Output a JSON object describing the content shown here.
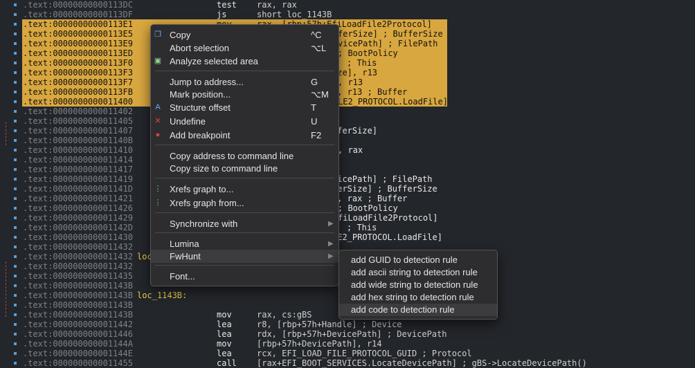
{
  "listing": [
    {
      "addr": ".text:00000000000113DC",
      "mn": "test",
      "op": "rax, rax",
      "comment": "",
      "label": "",
      "hl": false
    },
    {
      "addr": ".text:00000000000113DF",
      "mn": "js",
      "op": "short loc_1143B",
      "comment": "",
      "label": "",
      "hl": false
    },
    {
      "addr": ".text:00000000000113E1",
      "mn": "mov",
      "op": "rax, [rbp+57h+EfiLoadFile2Protocol]",
      "comment": "",
      "label": "",
      "hl": true
    },
    {
      "addr": ".text:00000000000113E5",
      "mn": "",
      "op": "",
      "comment": "ferSize] ; BufferSize",
      "label": "",
      "hl": true
    },
    {
      "addr": ".text:00000000000113E9",
      "mn": "",
      "op": "",
      "comment": "vicePath] ; FilePath",
      "label": "",
      "hl": true
    },
    {
      "addr": ".text:00000000000113ED",
      "mn": "",
      "op": "",
      "comment": "; BootPolicy",
      "label": "",
      "hl": true
    },
    {
      "addr": ".text:00000000000113F0",
      "mn": "",
      "op": "",
      "comment": "; This",
      "label": "",
      "hl": true
    },
    {
      "addr": ".text:00000000000113F3",
      "mn": "",
      "op": "",
      "comment": "ize], r13",
      "label": "",
      "hl": true
    },
    {
      "addr": ".text:00000000000113F7",
      "mn": "",
      "op": "",
      "comment": ", r13",
      "label": "",
      "hl": true
    },
    {
      "addr": ".text:00000000000113FB",
      "mn": "",
      "op": "",
      "comment": "], r13 ; Buffer",
      "label": "",
      "hl": true
    },
    {
      "addr": ".text:0000000000011400",
      "mn": "",
      "op": "",
      "comment": "LE2_PROTOCOL.LoadFile]",
      "label": "",
      "hl": true
    },
    {
      "addr": ".text:0000000000011402",
      "mn": "",
      "op": "",
      "comment": "",
      "label": "",
      "hl": false
    },
    {
      "addr": ".text:0000000000011405",
      "mn": "",
      "op": "",
      "comment": "",
      "label": "",
      "hl": false
    },
    {
      "addr": ".text:0000000000011407",
      "mn": "",
      "op": "",
      "comment": "fferSize]",
      "label": "",
      "hl": false
    },
    {
      "addr": ".text:000000000001140B",
      "mn": "",
      "op": "",
      "comment": "",
      "label": "",
      "hl": false
    },
    {
      "addr": ".text:0000000000011410",
      "mn": "",
      "op": "",
      "comment": ", rax",
      "label": "",
      "hl": false
    },
    {
      "addr": ".text:0000000000011414",
      "mn": "",
      "op": "",
      "comment": "",
      "label": "",
      "hl": false
    },
    {
      "addr": ".text:0000000000011417",
      "mn": "",
      "op": "",
      "comment": "",
      "label": "",
      "hl": false
    },
    {
      "addr": ".text:0000000000011419",
      "mn": "",
      "op": "",
      "comment": "vicePath] ; FilePath",
      "label": "",
      "hl": false
    },
    {
      "addr": ".text:000000000001141D",
      "mn": "",
      "op": "",
      "comment": "ferSize] ; BufferSize",
      "label": "",
      "hl": false
    },
    {
      "addr": ".text:0000000000011421",
      "mn": "",
      "op": "",
      "comment": "], rax ; Buffer",
      "label": "",
      "hl": false
    },
    {
      "addr": ".text:0000000000011426",
      "mn": "",
      "op": "",
      "comment": "; BootPolicy",
      "label": "",
      "hl": false
    },
    {
      "addr": ".text:0000000000011429",
      "mn": "",
      "op": "",
      "comment": "fiLoadFile2Protocol]",
      "label": "",
      "hl": false
    },
    {
      "addr": ".text:000000000001142D",
      "mn": "",
      "op": "",
      "comment": "; This",
      "label": "",
      "hl": false
    },
    {
      "addr": ".text:0000000000011430",
      "mn": "",
      "op": "",
      "comment": "LE2_PROTOCOL.LoadFile]",
      "label": "",
      "hl": false
    },
    {
      "addr": ".text:0000000000011432",
      "mn": "",
      "op": "",
      "comment": "",
      "label": "",
      "hl": false
    },
    {
      "addr": ".text:0000000000011432",
      "mn": "",
      "op": "",
      "comment": "",
      "label": "loc",
      "hl": false
    },
    {
      "addr": ".text:0000000000011432",
      "mn": "",
      "op": "",
      "comment": "",
      "label": "",
      "hl": false
    },
    {
      "addr": ".text:0000000000011435",
      "mn": "",
      "op": "",
      "comment": "",
      "label": "",
      "hl": false
    },
    {
      "addr": ".text:000000000001143B",
      "mn": "",
      "op": "",
      "comment": "",
      "label": "",
      "hl": false
    },
    {
      "addr": ".text:000000000001143B",
      "mn": "",
      "op": "",
      "comment": "",
      "label": "loc_1143B:",
      "hl": false
    },
    {
      "addr": ".text:000000000001143B",
      "mn": "",
      "op": "",
      "comment": "",
      "label": "",
      "hl": false
    },
    {
      "addr": ".text:000000000001143B",
      "mn": "mov",
      "op": "rax, cs:gBS",
      "comment": "",
      "label": "",
      "hl": false
    },
    {
      "addr": ".text:0000000000011442",
      "mn": "lea",
      "op": "r8, [rbp+57h+Handle] ; Device",
      "comment": "",
      "label": "",
      "hl": false
    },
    {
      "addr": ".text:0000000000011446",
      "mn": "lea",
      "op": "rdx, [rbp+57h+DevicePath] ; DevicePath",
      "comment": "",
      "label": "",
      "hl": false
    },
    {
      "addr": ".text:000000000001144A",
      "mn": "mov",
      "op": "[rbp+57h+DevicePath], r14",
      "comment": "",
      "label": "",
      "hl": false
    },
    {
      "addr": ".text:000000000001144E",
      "mn": "lea",
      "op": "rcx, EFI_LOAD_FILE_PROTOCOL_GUID ; Protocol",
      "comment": "",
      "label": "",
      "hl": false
    },
    {
      "addr": ".text:0000000000011455",
      "mn": "call",
      "op": "[rax+EFI_BOOT_SERVICES.LocateDevicePath] ; gBS->LocateDevicePath()",
      "comment": "",
      "label": "",
      "hl": false
    }
  ],
  "menu": {
    "items": [
      {
        "id": "copy",
        "label": "Copy",
        "shortcut": "^C",
        "icon": "copy-icon",
        "glyph": "❐",
        "color": "#6fa8ff",
        "submenu": false
      },
      {
        "id": "abort-selection",
        "label": "Abort selection",
        "shortcut": "⌥L",
        "icon": "",
        "glyph": "",
        "color": "",
        "submenu": false
      },
      {
        "id": "analyze-selected-area",
        "label": "Analyze selected area",
        "shortcut": "",
        "icon": "code-icon",
        "glyph": "▣",
        "color": "#8fd18f",
        "submenu": false
      },
      {
        "id": "jump-to-address",
        "label": "Jump to address...",
        "shortcut": "G",
        "icon": "",
        "glyph": "",
        "color": "",
        "submenu": false
      },
      {
        "id": "mark-position",
        "label": "Mark position...",
        "shortcut": "⌥M",
        "icon": "",
        "glyph": "",
        "color": "",
        "submenu": false
      },
      {
        "id": "structure-offset",
        "label": "Structure offset",
        "shortcut": "T",
        "icon": "structure-icon",
        "glyph": "A",
        "color": "#6fa8ff",
        "submenu": false
      },
      {
        "id": "undefine",
        "label": "Undefine",
        "shortcut": "U",
        "icon": "undefine-x-icon",
        "glyph": "✕",
        "color": "#e04040",
        "submenu": false
      },
      {
        "id": "add-breakpoint",
        "label": "Add breakpoint",
        "shortcut": "F2",
        "icon": "breakpoint-icon",
        "glyph": "●",
        "color": "#e04040",
        "submenu": false
      },
      {
        "id": "copy-address",
        "label": "Copy address to command line",
        "shortcut": "",
        "icon": "",
        "glyph": "",
        "color": "",
        "submenu": false
      },
      {
        "id": "copy-size",
        "label": "Copy size to command line",
        "shortcut": "",
        "icon": "",
        "glyph": "",
        "color": "",
        "submenu": false
      },
      {
        "id": "xrefs-graph-to",
        "label": "Xrefs graph to...",
        "shortcut": "",
        "icon": "xrefs-graph-to-icon",
        "glyph": "⋮",
        "color": "#5fd05f",
        "submenu": false
      },
      {
        "id": "xrefs-graph-from",
        "label": "Xrefs graph from...",
        "shortcut": "",
        "icon": "xrefs-graph-from-icon",
        "glyph": "⋮",
        "color": "#5fd05f",
        "submenu": false
      },
      {
        "id": "synchronize-with",
        "label": "Synchronize with",
        "shortcut": "",
        "icon": "",
        "glyph": "",
        "color": "",
        "submenu": true
      },
      {
        "id": "lumina",
        "label": "Lumina",
        "shortcut": "",
        "icon": "",
        "glyph": "",
        "color": "",
        "submenu": true
      },
      {
        "id": "fwhunt",
        "label": "FwHunt",
        "shortcut": "",
        "icon": "",
        "glyph": "",
        "color": "",
        "submenu": true
      },
      {
        "id": "font",
        "label": "Font...",
        "shortcut": "",
        "icon": "",
        "glyph": "",
        "color": "",
        "submenu": false
      }
    ],
    "submenu_arrow": "▶"
  },
  "submenu": {
    "items": [
      {
        "id": "add-guid",
        "label": "add GUID to detection rule"
      },
      {
        "id": "add-ascii",
        "label": "add ascii string to detection rule"
      },
      {
        "id": "add-wide",
        "label": "add wide string to detection rule"
      },
      {
        "id": "add-hex",
        "label": "add hex string to detection rule"
      },
      {
        "id": "add-code",
        "label": "add code to detection rule"
      }
    ]
  },
  "colors": {
    "highlight": "#d9a73f",
    "background": "#23262b",
    "label": "#f0c94a"
  }
}
